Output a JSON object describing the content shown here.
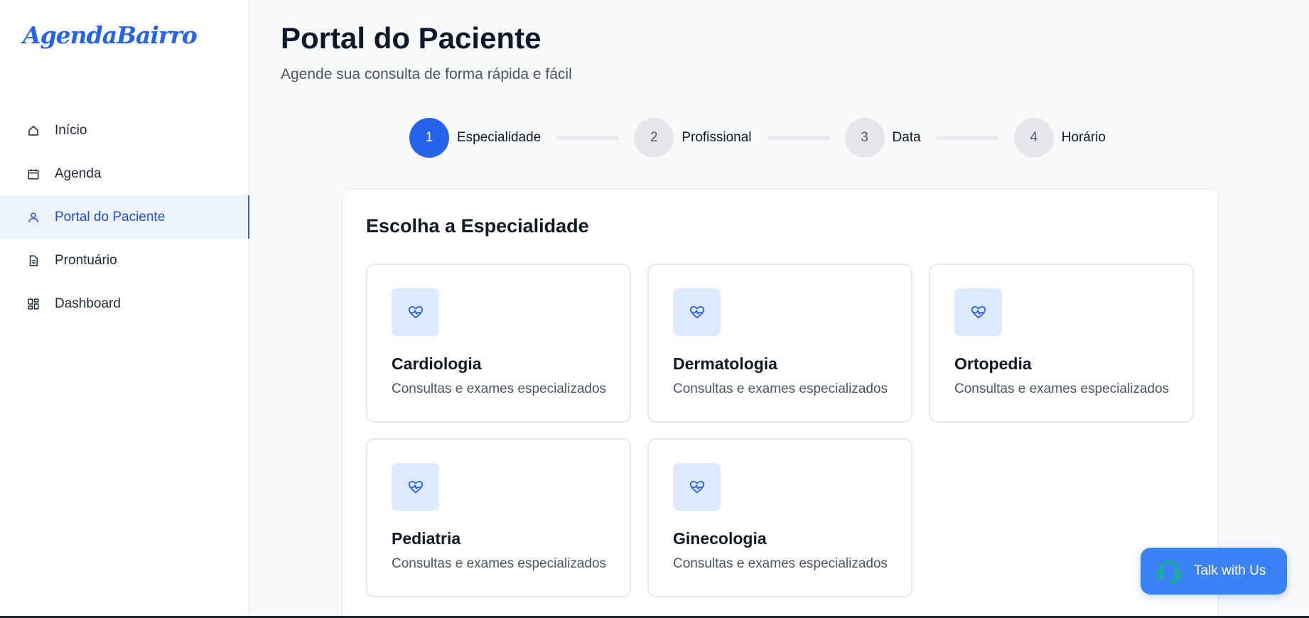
{
  "app": {
    "logo": "AgendaBairro",
    "brand_color": "#2563eb"
  },
  "sidebar": {
    "items": [
      {
        "label": "Início",
        "icon": "home-icon",
        "active": false
      },
      {
        "label": "Agenda",
        "icon": "calendar-icon",
        "active": false
      },
      {
        "label": "Portal do Paciente",
        "icon": "user-icon",
        "active": true
      },
      {
        "label": "Prontuário",
        "icon": "document-icon",
        "active": false
      },
      {
        "label": "Dashboard",
        "icon": "dashboard-icon",
        "active": false
      }
    ]
  },
  "header": {
    "title": "Portal do Paciente",
    "subtitle": "Agende sua consulta de forma rápida e fácil"
  },
  "stepper": {
    "current_step": 1,
    "steps": [
      {
        "number": "1",
        "label": "Especialidade"
      },
      {
        "number": "2",
        "label": "Profissional"
      },
      {
        "number": "3",
        "label": "Data"
      },
      {
        "number": "4",
        "label": "Horário"
      }
    ]
  },
  "selection": {
    "title": "Escolha a Especialidade",
    "specialties": [
      {
        "name": "Cardiologia",
        "description": "Consultas e exames especializados",
        "icon": "heart-pulse-icon"
      },
      {
        "name": "Dermatologia",
        "description": "Consultas e exames especializados",
        "icon": "heart-pulse-icon"
      },
      {
        "name": "Ortopedia",
        "description": "Consultas e exames especializados",
        "icon": "heart-pulse-icon"
      },
      {
        "name": "Pediatria",
        "description": "Consultas e exames especializados",
        "icon": "heart-pulse-icon"
      },
      {
        "name": "Ginecologia",
        "description": "Consultas e exames especializados",
        "icon": "heart-pulse-icon"
      }
    ]
  },
  "chat": {
    "label": "Talk with Us",
    "icon": "headset-icon",
    "color": "#3b82f6"
  }
}
